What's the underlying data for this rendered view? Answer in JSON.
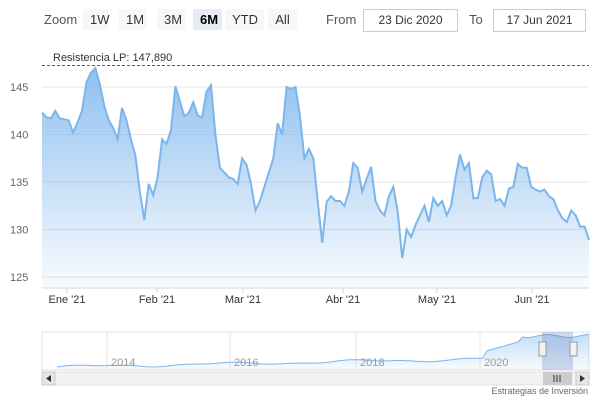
{
  "range_selector": {
    "zoom_label": "Zoom",
    "buttons": [
      "1W",
      "1M",
      "3M",
      "6M",
      "YTD",
      "All"
    ],
    "active": "6M",
    "from_label": "From",
    "from_value": "23 Dic 2020",
    "to_label": "To",
    "to_value": "17 Jun 2021"
  },
  "annotation": {
    "label": "Resistencia LP: 147,890",
    "value": 147.89
  },
  "credit": "Estrategias de Inversión",
  "colors": {
    "line": "#7cb5ec",
    "area_top": "#7cb5ec",
    "resistance": "#2e7d32",
    "grid": "#e6e6e6",
    "active_button": "#e6ebf5"
  },
  "chart_data": {
    "type": "area",
    "ylim": [
      125,
      148
    ],
    "yticks": [
      125,
      130,
      135,
      140,
      145
    ],
    "x_ticks": [
      "Ene '21",
      "Feb '21",
      "Mar '21",
      "Abr '21",
      "May '21",
      "Jun '21"
    ],
    "grid": true,
    "series": [
      {
        "values": [
          142.3,
          141.8,
          141.7,
          142.5,
          141.7,
          141.6,
          141.5,
          140.2,
          141.3,
          142.5,
          145.5,
          146.5,
          147.0,
          145.3,
          143.0,
          141.5,
          140.7,
          139.5,
          142.8,
          141.5,
          139.5,
          137.8,
          134.0,
          131.0,
          134.8,
          133.6,
          135.5,
          139.5,
          139.0,
          140.5,
          145.1,
          143.5,
          141.9,
          142.3,
          143.4,
          142.0,
          141.8,
          144.5,
          145.2,
          140.0,
          136.5,
          136.0,
          135.5,
          135.3,
          134.8,
          137.5,
          136.8,
          134.8,
          132.0,
          133.0,
          134.5,
          136.0,
          137.5,
          141.2,
          140.0,
          145.0,
          144.8,
          145.0,
          142.0,
          137.5,
          138.5,
          137.5,
          133.0,
          128.6,
          132.9,
          133.5,
          133.0,
          133.0,
          132.5,
          134.0,
          137.0,
          136.5,
          134.0,
          135.3,
          136.6,
          133.0,
          132.0,
          131.5,
          133.5,
          134.5,
          131.8,
          127.0,
          130.0,
          129.2,
          130.5,
          131.5,
          132.5,
          130.8,
          133.3,
          132.5,
          133.0,
          131.5,
          132.5,
          135.5,
          137.9,
          136.3,
          137.0,
          133.3,
          133.3,
          135.5,
          136.2,
          135.8,
          133.0,
          133.2,
          132.5,
          134.3,
          134.5,
          136.9,
          136.5,
          136.5,
          134.5,
          134.2,
          134.0,
          134.2,
          133.5,
          133.2,
          132.0,
          131.2,
          130.8,
          132.0,
          131.5,
          130.3,
          130.3,
          128.9
        ]
      }
    ],
    "navigator_years": [
      "2014",
      "2016",
      "2018",
      "2020"
    ]
  }
}
